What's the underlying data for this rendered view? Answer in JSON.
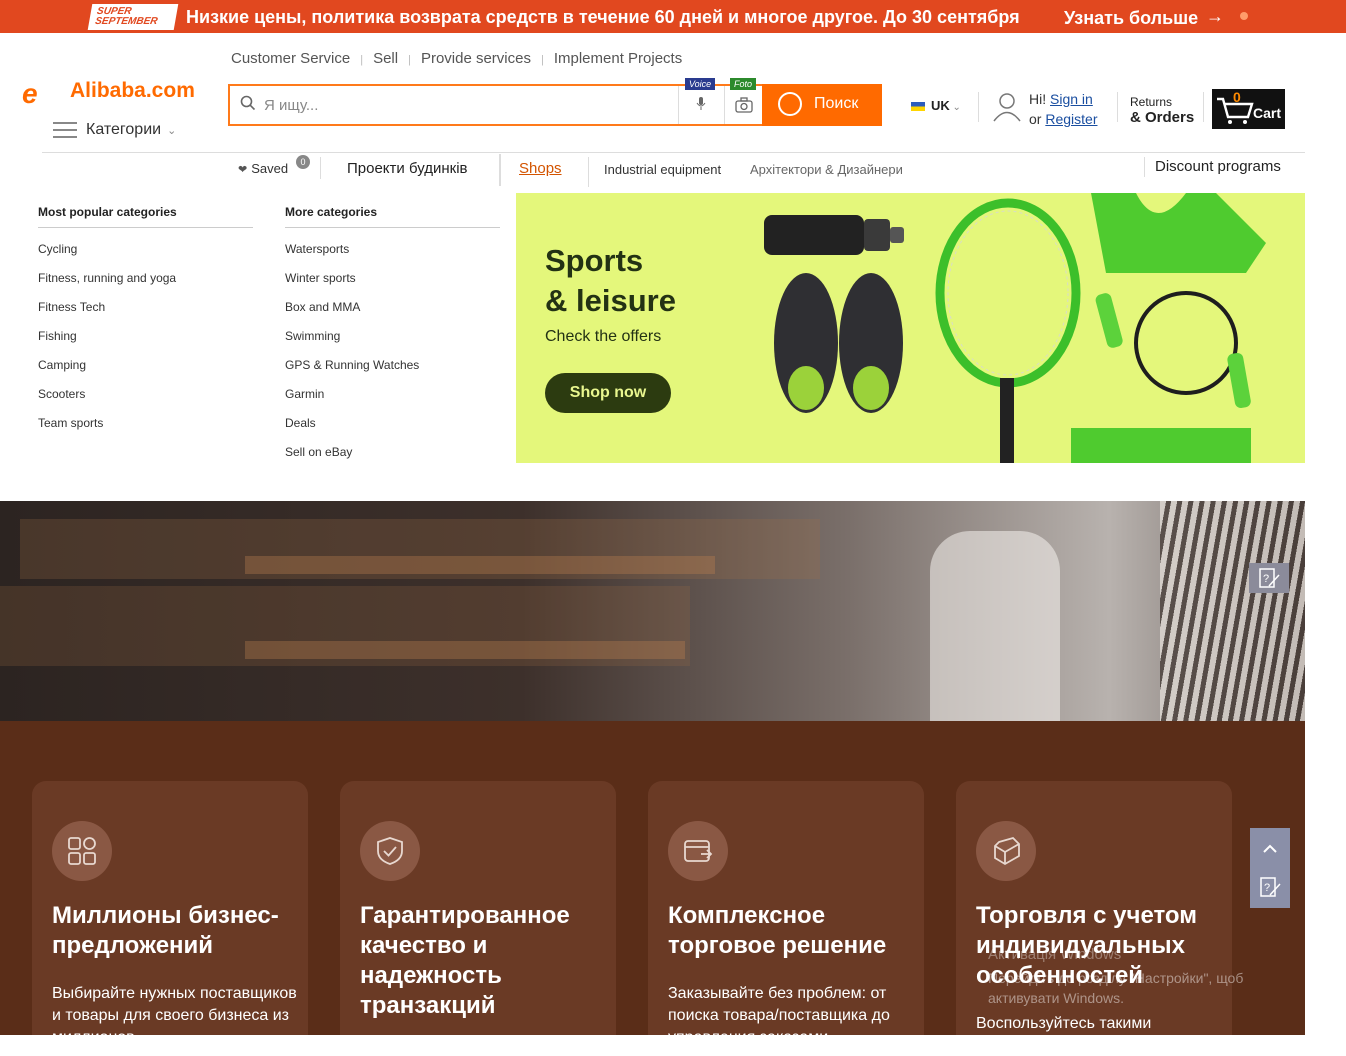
{
  "promo": {
    "badge_line1": "SUPER",
    "badge_line2": "SEPTEMBER",
    "text": "Низкие цены, политика возврата средств в течение 60 дней и многое другое. До 30 сентября",
    "link": "Узнать больше",
    "arrow": "→",
    "color": "#e1481f"
  },
  "header": {
    "toplinks": [
      "Customer Service",
      "Sell",
      "Provide services",
      "Implement Projects"
    ],
    "logo_mark": "e",
    "logo_text": "Alibaba.com",
    "categories_label": "Категории",
    "search": {
      "placeholder": "Я ищу...",
      "voice_tag": "Voice",
      "foto_tag": "Foto",
      "button_label": "Поиск",
      "accent": "#ff6a00"
    },
    "language": "UK",
    "greeting": "Hi!",
    "sign_in": "Sign in",
    "or": "or",
    "register": "Register",
    "returns": "Returns",
    "orders": "& Orders",
    "cart_count": "0",
    "cart_label": "Cart"
  },
  "subnav": {
    "saved_label": "Saved",
    "saved_count": "0",
    "projects": "Проекти будинків",
    "shops": "Shops",
    "industrial": "Industrial equipment",
    "architects": "Архітектори & Дизайнери",
    "discount": "Discount programs"
  },
  "dropdown": {
    "popular_title": "Most popular categories",
    "popular": [
      "Cycling",
      "Fitness, running and yoga",
      "Fitness Tech",
      "Fishing",
      "Camping",
      "Scooters",
      "Team sports"
    ],
    "more_title": "More categories",
    "more": [
      "Watersports",
      "Winter sports",
      "Box and MMA",
      "Swimming",
      "GPS & Running Watches",
      "Garmin",
      "Deals",
      "Sell on eBay"
    ]
  },
  "banner": {
    "title_line1": "Sports",
    "title_line2": "& leisure",
    "subtitle": "Check the offers",
    "button": "Shop now",
    "bg": "#e4f77b"
  },
  "features": [
    {
      "icon": "grid-icon",
      "title": "Миллионы бизнес-предложений",
      "desc": "Выбирайте нужных поставщиков и товары для своего бизнеса из миллионов"
    },
    {
      "icon": "shield-check-icon",
      "title": "Гарантированное качество и надежность транзакций",
      "desc": ""
    },
    {
      "icon": "payment-card-icon",
      "title": "Комплексное торговое решение",
      "desc": "Заказывайте без проблем: от поиска товара/поставщика до управления заказами"
    },
    {
      "icon": "cube-icon",
      "title": "Торговля с учетом индивидуальных особенностей",
      "desc": "Воспользуйтесь такими"
    }
  ],
  "watermark": {
    "line1": "Активація Windows",
    "line2": "Перейдіть до розділу \"Настройки\", щоб",
    "line3": "активувати Windows."
  }
}
